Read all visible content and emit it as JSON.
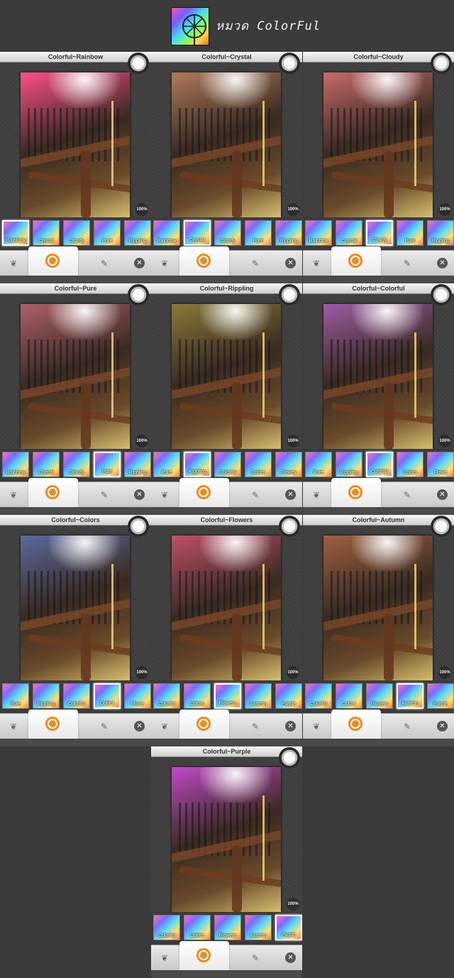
{
  "header": {
    "title": "หมวด ColorFul",
    "logo_icon": "ferris-wheel-icon"
  },
  "panels": [
    {
      "title": "Colorful~Rainbow",
      "zoom": "100%",
      "tint": "#ff4f8a",
      "thumbs": [
        "Rainbow",
        "Crystal",
        "Cloudy",
        "Pure",
        "Rippling"
      ],
      "selected": 0
    },
    {
      "title": "Colorful~Crystal",
      "zoom": "100%",
      "tint": "#b07a5a",
      "thumbs": [
        "Rainbow",
        "Crystal",
        "Cloudy",
        "Pure",
        "Rippling"
      ],
      "selected": 1
    },
    {
      "title": "Colorful~Cloudy",
      "zoom": "100%",
      "tint": "#c86a6a",
      "thumbs": [
        "Rainbow",
        "Crystal",
        "Cloudy",
        "Pure",
        "Rippling"
      ],
      "selected": 2
    },
    {
      "title": "Colorful~Pure",
      "zoom": "100%",
      "tint": "#b0606a",
      "thumbs": [
        "Rainbow",
        "Crystal",
        "Cloudy",
        "Pure",
        "Rippling"
      ],
      "selected": 3
    },
    {
      "title": "Colorful~Rippling",
      "zoom": "100%",
      "tint": "#8a7a3a",
      "thumbs": [
        "Pure",
        "Rippling",
        "Colorful",
        "Colors",
        "Flowey"
      ],
      "selected": 1
    },
    {
      "title": "Colorful~Colorful",
      "zoom": "100%",
      "tint": "#a05aa8",
      "thumbs": [
        "Pure",
        "Rippling",
        "Colorful",
        "Colors",
        "Flowe"
      ],
      "selected": 2
    },
    {
      "title": "Colorful~Colors",
      "zoom": "100%",
      "tint": "#5a6aa0",
      "thumbs": [
        "Pure",
        "Rippling",
        "Colorful",
        "Colors",
        "Flowe"
      ],
      "selected": 3
    },
    {
      "title": "Colorful~Flowers",
      "zoom": "100%",
      "tint": "#c05068",
      "thumbs": [
        "Colorful",
        "Colors",
        "Flowers",
        "Autumn",
        "Purple"
      ],
      "selected": 2
    },
    {
      "title": "Colorful~Autumn",
      "zoom": "100%",
      "tint": "#a06040",
      "thumbs": [
        "Colorful",
        "Colors",
        "Flowers",
        "Autumn",
        "Purple"
      ],
      "selected": 3
    },
    {
      "title": "Colorful~Purple",
      "zoom": "100%",
      "tint": "#c04ac8",
      "thumbs": [
        "Colorful",
        "Colors",
        "Flowers",
        "Autumn",
        "Purple"
      ],
      "selected": 4
    }
  ],
  "toolbar": {
    "left_icon": "heart-tools-icon",
    "center_icon": "camera-capture-icon",
    "pencil_icon": "pencil-magic-icon",
    "close_icon": "close-icon"
  }
}
